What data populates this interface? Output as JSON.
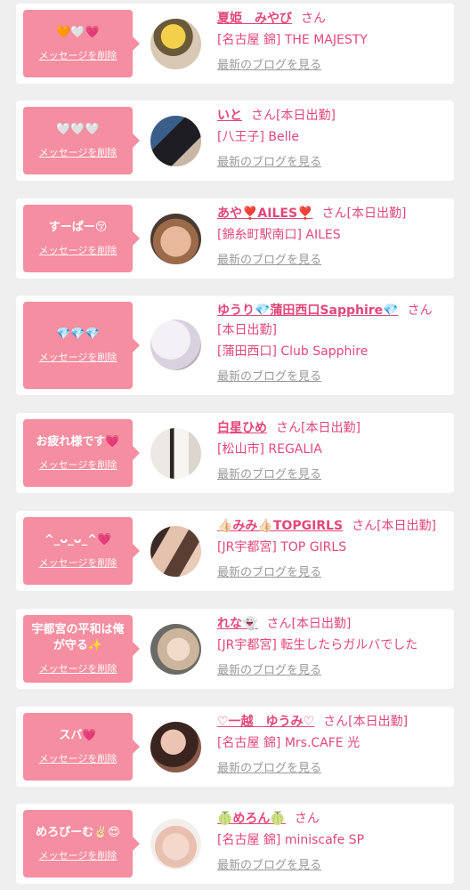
{
  "delete_label": "メッセージを削除",
  "san_label": "さん",
  "blog_label": "最新のブログを見る",
  "entries": [
    {
      "message": "🧡🤍💗",
      "name": "夏姫　みやび",
      "status": "",
      "shop": "[名古屋 錦] THE MAJESTY"
    },
    {
      "message": "🤍🤍🤍",
      "name": "いと",
      "status": "[本日出勤]",
      "shop": "[八王子] Belle"
    },
    {
      "message": "すーぱー😚",
      "name": "あや❣️AILES❣️",
      "status": "[本日出勤]",
      "shop": "[錦糸町駅南口] AILES"
    },
    {
      "message": "💎💎💎",
      "name": "ゆうり💎蒲田西口Sapphire💎",
      "status": "[本日出勤]",
      "shop": "[蒲田西口] Club Sapphire"
    },
    {
      "message": "お疲れ様です💗",
      "name": "白星ひめ",
      "status": "[本日出勤]",
      "shop": "[松山市] REGALIA"
    },
    {
      "message": "^_ᴗ_ᴗ_^💗",
      "name": "👍🏻みみ👍🏻TOPGIRLS",
      "status": "[本日出勤]",
      "shop": "[JR宇都宮] TOP GIRLS"
    },
    {
      "message": "宇都宮の平和は俺が守る✨",
      "name": "れな👻",
      "status": "[本日出勤]",
      "shop": "[JR宇都宮] 転生したらガルバでした"
    },
    {
      "message": "スバ💗",
      "name": "♡一越　ゆうみ♡",
      "status": "[本日出勤]",
      "shop": "[名古屋 錦] Mrs.CAFE 光"
    },
    {
      "message": "めろぴーむ✌🏻😍",
      "name": "🍈めろん🍈",
      "status": "",
      "shop": "[名古屋 錦] miniscafe SP"
    }
  ]
}
